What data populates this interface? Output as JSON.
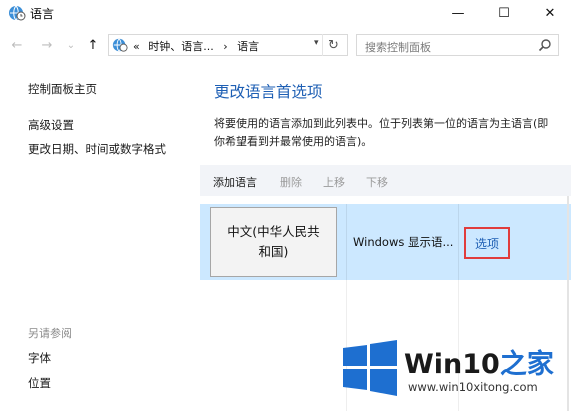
{
  "window": {
    "title": "语言",
    "icon": "globe-clock-icon",
    "controls": {
      "minimize": "—",
      "maximize": "☐",
      "close": "✕"
    }
  },
  "nav": {
    "back": "←",
    "forward": "→",
    "recent": "⌄",
    "up": "↑",
    "breadcrumb": [
      "«",
      "时钟、语言...",
      "›",
      "语言"
    ],
    "refresh": "↻",
    "search_placeholder": "搜索控制面板",
    "search_icon": "search-icon"
  },
  "sidebar": {
    "home": "控制面板主页",
    "links": [
      "高级设置",
      "更改日期、时间或数字格式"
    ],
    "see_also_label": "另请参阅",
    "see_also": [
      "字体",
      "位置"
    ]
  },
  "main": {
    "heading": "更改语言首选项",
    "description": "将要使用的语言添加到此列表中。位于列表第一位的语言为主语言(即你希望看到并最常使用的语言)。",
    "toolbar": [
      "添加语言",
      "删除",
      "上移",
      "下移"
    ],
    "language_row": {
      "name_line1": "中文(中华人民共",
      "name_line2": "和国)",
      "info": "Windows 显示语...",
      "options": "选项"
    }
  },
  "watermark": {
    "title_main": "Win10",
    "title_suffix": "之家",
    "url": "www.win10xitong.com",
    "logo_colors": [
      "#1e6fd0",
      "#1e6fd0",
      "#1e6fd0",
      "#1e6fd0"
    ]
  },
  "colors": {
    "link_blue": "#1e5fb4",
    "selection_row": "#cce8ff",
    "highlight_border": "#e03c3c"
  }
}
